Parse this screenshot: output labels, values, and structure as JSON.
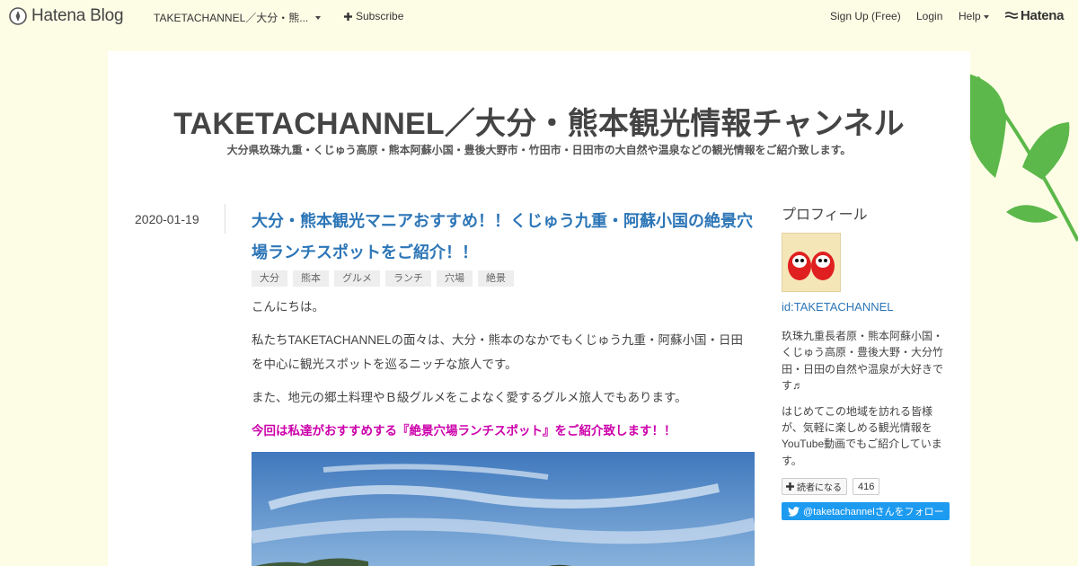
{
  "globalbar": {
    "logo_text": "Hatena Blog",
    "blog_name": "TAKETACHANNEL／大分・熊...",
    "subscribe_label": "Subscribe",
    "signup_label": "Sign Up (Free)",
    "login_label": "Login",
    "help_label": "Help",
    "hatena_label": "Hatena"
  },
  "blog": {
    "title": "TAKETACHANNEL／大分・熊本観光情報チャンネル",
    "description": "大分県玖珠九重・くじゅう高原・熊本阿蘇小国・豊後大野市・竹田市・日田市の大自然や温泉などの観光情報をご紹介致します。"
  },
  "entry": {
    "date": "2020-01-19",
    "title": "大分・熊本観光マニアおすすめ！！くじゅう九重・阿蘇小国の絶景穴場ランチスポットをご紹介！！",
    "categories": [
      "大分",
      "熊本",
      "グルメ",
      "ランチ",
      "穴場",
      "絶景"
    ],
    "paragraphs": [
      "こんにちは。",
      "私たちTAKETACHANNELの面々は、大分・熊本のなかでもくじゅう九重・阿蘇小国・日田を中心に観光スポットを巡るニッチな旅人です。",
      "また、地元の郷土料理やＢ級グルメをこよなく愛するグルメ旅人でもあります。"
    ],
    "highlight": "今回は私達がおすすめする『絶景穴場ランチスポット』をご紹介致します！！"
  },
  "sidebar": {
    "heading": "プロフィール",
    "profile_id": "id:TAKETACHANNEL",
    "bio_1": "玖珠九重長者原・熊本阿蘇小国・くじゅう高原・豊後大野・大分竹田・日田の自然や温泉が大好きです♬",
    "bio_2": "はじめてこの地域を訪れる皆様が、気軽に楽しめる観光情報をYouTube動画でもご紹介しています。",
    "reader_button": "読者になる",
    "reader_count": "416",
    "twitter_follow": "@taketachannelさんをフォロー"
  },
  "colors": {
    "background": "#fdfde6",
    "link": "#2d76b7",
    "highlight": "#cc00aa",
    "twitter": "#1d9bf0",
    "leaf": "#5cb84a"
  }
}
